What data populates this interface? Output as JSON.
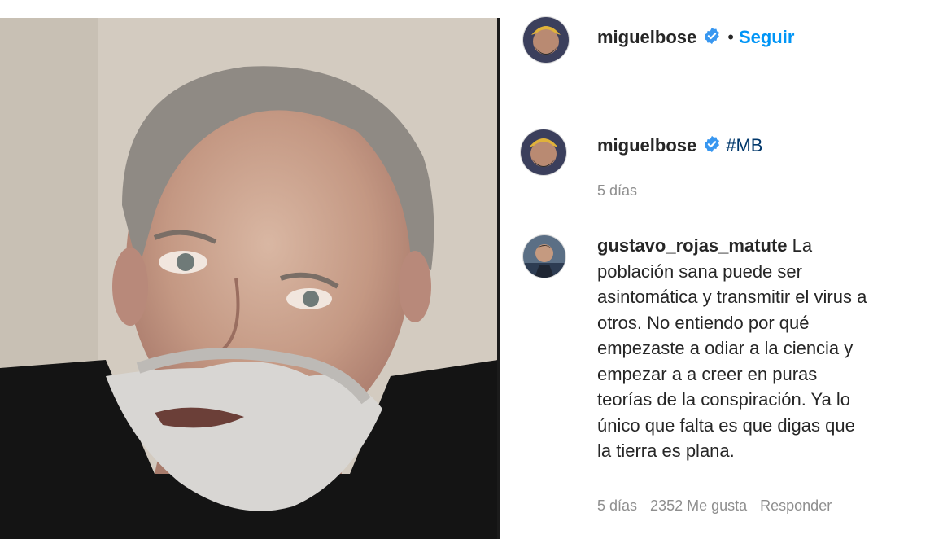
{
  "header": {
    "username": "miguelbose",
    "separator": "•",
    "follow_label": "Seguir"
  },
  "caption": {
    "username": "miguelbose",
    "text": "#MB",
    "time": "5 días"
  },
  "comment": {
    "username": "gustavo_rojas_matute",
    "text_lines": [
      " La",
      "población sana puede ser",
      "asintomática y transmitir el virus a",
      "otros. No entiendo por qué",
      "empezaste a odiar a la ciencia y",
      "empezar a a creer en puras",
      "teorías de la conspiración. Ya lo",
      "único que falta es que digas que",
      "la tierra es plana."
    ],
    "time": "5 días",
    "likes": "2352 Me gusta",
    "reply_label": "Responder"
  },
  "colors": {
    "accent": "#0095f6",
    "verified": "#3897f0",
    "secondary_text": "#8e8e8e"
  },
  "icons": {
    "verified": "verified-badge-icon"
  }
}
